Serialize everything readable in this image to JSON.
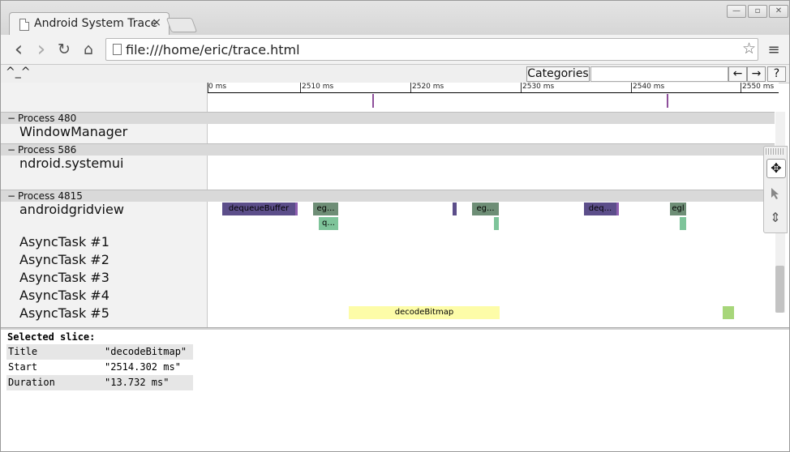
{
  "browser": {
    "tab_title": "Android System Trace",
    "tab_close": "×",
    "url": "file:///home/eric/trace.html",
    "nav": {
      "back": "‹",
      "forward": "›",
      "reload": "↻",
      "home": "⌂",
      "star": "☆",
      "menu": "≡"
    }
  },
  "trace_toolbar": {
    "logo": "^_^",
    "categories_label": "Categories",
    "filter_value": "",
    "prev": "←",
    "next": "→",
    "help": "?"
  },
  "timeline": {
    "ticks": [
      "0 ms",
      "2510 ms",
      "2520 ms",
      "2530 ms",
      "2540 ms",
      "2550 ms"
    ]
  },
  "processes": [
    {
      "label": "Process 480",
      "threads": [
        "WindowManager"
      ]
    },
    {
      "label": "Process 586",
      "threads": [
        "ndroid.systemui"
      ]
    },
    {
      "label": "Process 4815",
      "threads": [
        "androidgridview",
        "AsyncTask #1",
        "AsyncTask #2",
        "AsyncTask #3",
        "AsyncTask #4",
        "AsyncTask #5"
      ]
    }
  ],
  "slices": {
    "dequeue1": "dequeueBuffer",
    "eg1": "eg...",
    "q1": "q...",
    "eg2": "eg...",
    "deq2": "deq...",
    "egl": "egl",
    "decode": "decodeBitmap"
  },
  "analysis": {
    "heading": "Selected slice:",
    "rows": [
      {
        "key": "Title",
        "value": "\"decodeBitmap\""
      },
      {
        "key": "Start",
        "value": "\"2514.302 ms\""
      },
      {
        "key": "Duration",
        "value": "\"13.732 ms\""
      }
    ]
  },
  "colors": {
    "dequeue": "#5c4e8a",
    "egl": "#6e8e76",
    "queue": "#7ec49a",
    "decode": "#fdfca8",
    "marker": "#8e4f9b",
    "green_small": "#a7d67a"
  },
  "tools": {
    "pan": "✥",
    "select": "arrow-icon",
    "zoom": "⇕"
  }
}
